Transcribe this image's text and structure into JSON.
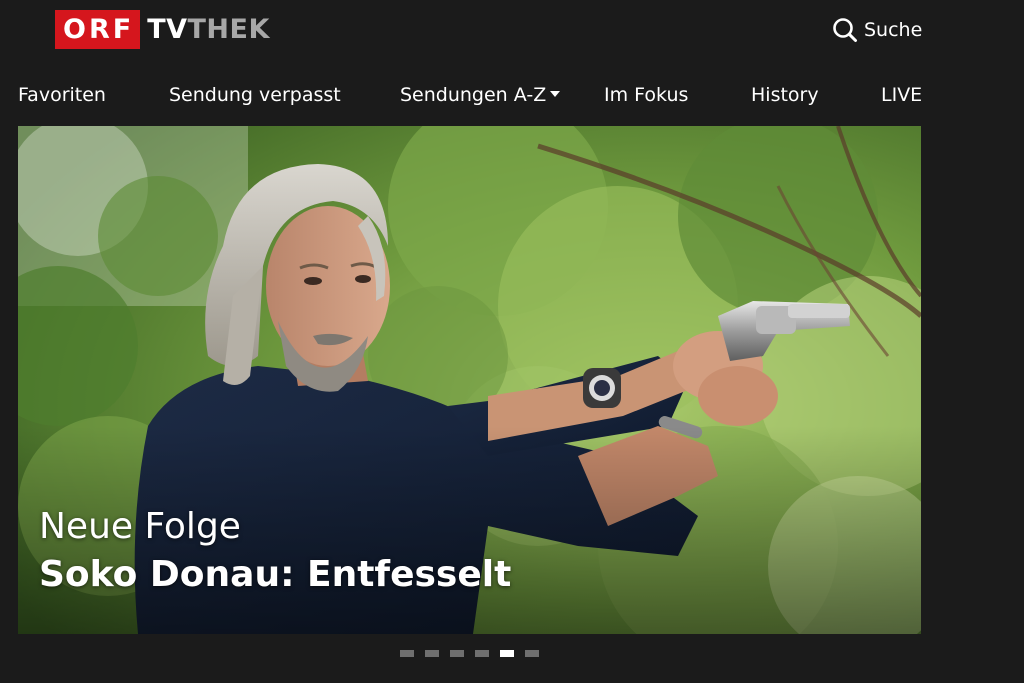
{
  "header": {
    "logo": {
      "part1": "ORF",
      "part2": "TV",
      "part3": "THEK"
    },
    "search_label": "Suche",
    "search_icon": "search-icon"
  },
  "nav": {
    "items": [
      {
        "label": "Favoriten"
      },
      {
        "label": "Sendung verpasst"
      },
      {
        "label": "Sendungen A-Z",
        "has_dropdown": true
      },
      {
        "label": "Im Fokus"
      },
      {
        "label": "History"
      },
      {
        "label": "LIVE"
      }
    ]
  },
  "hero": {
    "subtitle": "Neue Folge",
    "title": "Soko Donau: Entfesselt"
  },
  "pager": {
    "total": 6,
    "active_index": 4
  },
  "colors": {
    "background": "#1b1b1b",
    "brand_red": "#d5161d",
    "logo_grey": "#a7a7a7",
    "dot_inactive": "#6f6f6f",
    "dot_active": "#ffffff"
  }
}
